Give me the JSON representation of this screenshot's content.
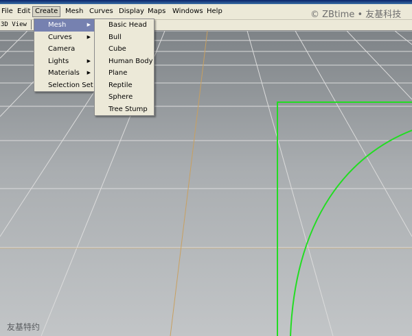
{
  "menubar": {
    "items": [
      "File",
      "Edit",
      "Create",
      "Mesh",
      "Curves",
      "Display",
      "Maps",
      "Windows",
      "Help"
    ],
    "active": "Create"
  },
  "watermark_top": "© ZBtime • 友基科技",
  "view_tab": "3D View",
  "create_menu": {
    "items": [
      {
        "label": "Mesh",
        "submenu": true,
        "highlighted": true
      },
      {
        "label": "Curves",
        "submenu": true
      },
      {
        "label": "Camera",
        "submenu": false
      },
      {
        "label": "Lights",
        "submenu": true
      },
      {
        "label": "Materials",
        "submenu": true
      },
      {
        "label": "Selection Set",
        "submenu": false
      }
    ]
  },
  "mesh_menu": {
    "items": [
      "Basic Head",
      "Bull",
      "Cube",
      "Human Body",
      "Plane",
      "Reptile",
      "Sphere",
      "Tree Stump"
    ]
  },
  "watermark_bottom": "友基特约",
  "colors": {
    "selection_green": "#22dd22",
    "menu_highlight": "#7681b0",
    "menu_bg": "#ece9d8",
    "grid_line": "#dcdcdc",
    "axis_line": "#c8a060"
  },
  "icons": {
    "submenu_arrow": "▶"
  }
}
